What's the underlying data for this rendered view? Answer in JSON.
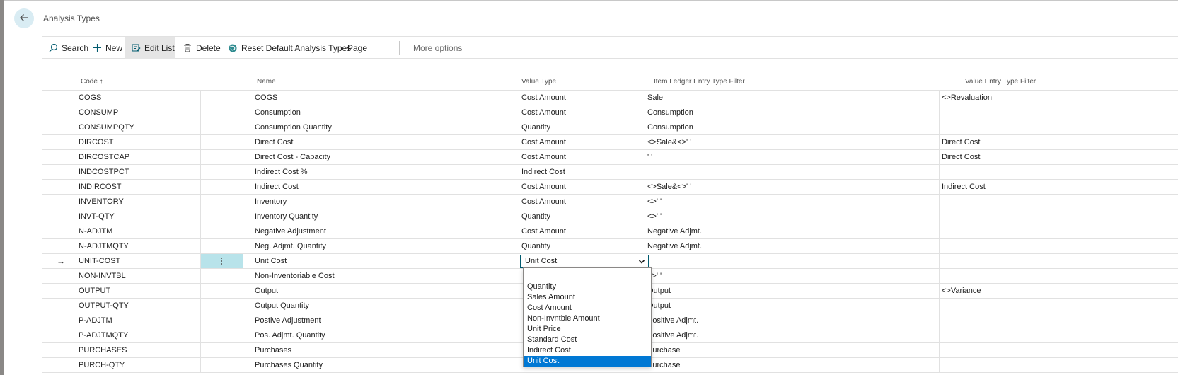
{
  "page": {
    "title": "Analysis Types"
  },
  "toolbar": {
    "search": "Search",
    "new": "New",
    "edit_list": "Edit List",
    "delete": "Delete",
    "reset": "Reset Default Analysis Types",
    "page": "Page",
    "more": "More options"
  },
  "columns": {
    "code": "Code ↑",
    "name": "Name",
    "value_type": "Value Type",
    "item_filter": "Item Ledger Entry Type Filter",
    "value_filter": "Value Entry Type Filter"
  },
  "rows": [
    {
      "code": "COGS",
      "name": "COGS",
      "value_type": "Cost Amount",
      "item_filter": "Sale",
      "value_filter": "<>Revaluation"
    },
    {
      "code": "CONSUMP",
      "name": "Consumption",
      "value_type": "Cost Amount",
      "item_filter": "Consumption",
      "value_filter": ""
    },
    {
      "code": "CONSUMPQTY",
      "name": "Consumption Quantity",
      "value_type": "Quantity",
      "item_filter": "Consumption",
      "value_filter": ""
    },
    {
      "code": "DIRCOST",
      "name": "Direct Cost",
      "value_type": "Cost Amount",
      "item_filter": "<>Sale&<>' '",
      "value_filter": "Direct Cost"
    },
    {
      "code": "DIRCOSTCAP",
      "name": "Direct Cost - Capacity",
      "value_type": "Cost Amount",
      "item_filter": "' '",
      "value_filter": "Direct Cost"
    },
    {
      "code": "INDCOSTPCT",
      "name": "Indirect Cost %",
      "value_type": "Indirect Cost",
      "item_filter": "",
      "value_filter": ""
    },
    {
      "code": "INDIRCOST",
      "name": "Indirect Cost",
      "value_type": "Cost Amount",
      "item_filter": "<>Sale&<>' '",
      "value_filter": "Indirect Cost"
    },
    {
      "code": "INVENTORY",
      "name": "Inventory",
      "value_type": "Cost Amount",
      "item_filter": "<>' '",
      "value_filter": ""
    },
    {
      "code": "INVT-QTY",
      "name": "Inventory Quantity",
      "value_type": "Quantity",
      "item_filter": "<>' '",
      "value_filter": ""
    },
    {
      "code": "N-ADJTM",
      "name": "Negative Adjustment",
      "value_type": "Cost Amount",
      "item_filter": "Negative Adjmt.",
      "value_filter": ""
    },
    {
      "code": "N-ADJTMQTY",
      "name": "Neg. Adjmt. Quantity",
      "value_type": "Quantity",
      "item_filter": "Negative Adjmt.",
      "value_filter": ""
    },
    {
      "code": "UNIT-COST",
      "name": "Unit Cost",
      "value_type": "Unit Cost",
      "item_filter": "",
      "value_filter": ""
    },
    {
      "code": "NON-INVTBL",
      "name": "Non-Inventoriable Cost",
      "value_type": "",
      "item_filter": "<>' '",
      "value_filter": ""
    },
    {
      "code": "OUTPUT",
      "name": "Output",
      "value_type": "",
      "item_filter": "Output",
      "value_filter": "<>Variance"
    },
    {
      "code": "OUTPUT-QTY",
      "name": "Output Quantity",
      "value_type": "",
      "item_filter": "Output",
      "value_filter": ""
    },
    {
      "code": "P-ADJTM",
      "name": "Postive Adjustment",
      "value_type": "",
      "item_filter": "Positive Adjmt.",
      "value_filter": ""
    },
    {
      "code": "P-ADJTMQTY",
      "name": "Pos. Adjmt. Quantity",
      "value_type": "",
      "item_filter": "Positive Adjmt.",
      "value_filter": ""
    },
    {
      "code": "PURCHASES",
      "name": "Purchases",
      "value_type": "",
      "item_filter": "Purchase",
      "value_filter": ""
    },
    {
      "code": "PURCH-QTY",
      "name": "Purchases Quantity",
      "value_type": "",
      "item_filter": "Purchase",
      "value_filter": ""
    }
  ],
  "current_row": {
    "arrow": "→",
    "selected_value": "Unit Cost"
  },
  "dropdown": {
    "options": [
      "",
      "Quantity",
      "Sales Amount",
      "Cost Amount",
      "Non-Invntble Amount",
      "Unit Price",
      "Standard Cost",
      "Indirect Cost",
      "Unit Cost"
    ],
    "selected": "Unit Cost"
  },
  "colors": {
    "accent": "#005a6e",
    "selected_option": "#0078d4",
    "current_grip": "#b8e3ea"
  }
}
